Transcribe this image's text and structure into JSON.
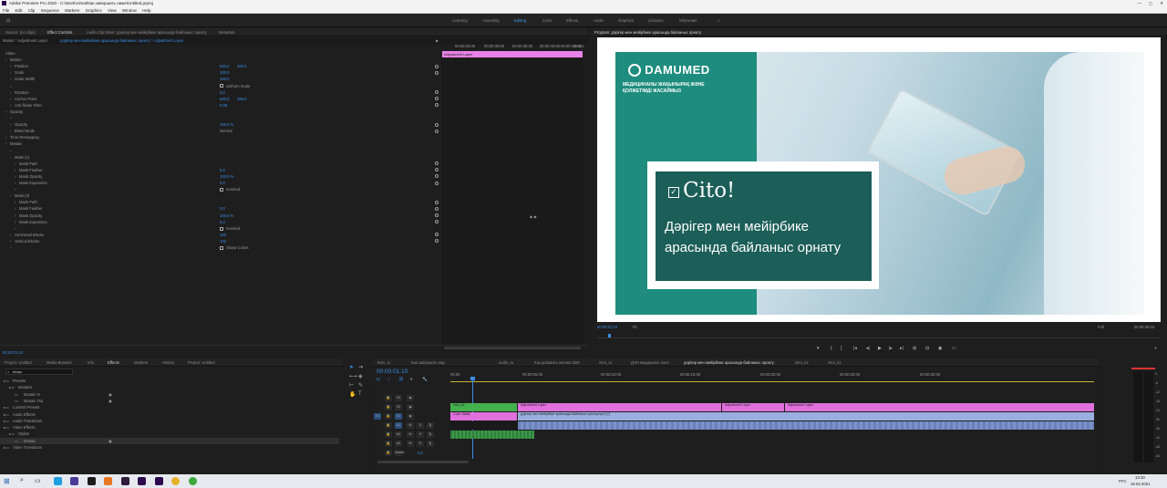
{
  "titlebar": {
    "title": "Adobe Premiere Pro 2020 - C:\\Work\\Almat\\Как завершить ниже\\Untitled.prproj"
  },
  "menu": [
    "File",
    "Edit",
    "Clip",
    "Sequence",
    "Markers",
    "Graphics",
    "View",
    "Window",
    "Help"
  ],
  "workspaces": [
    "Learning",
    "Assembly",
    "Editing",
    "Color",
    "Effects",
    "Audio",
    "Graphics",
    "Libraries",
    "Обучение"
  ],
  "workspace_active": "Editing",
  "source_tabs": {
    "source": "Source: (no clips)",
    "effect_controls": "Effect Controls",
    "audio_mixer": "Audio Clip Mixer: дәрігер мен мейірбике арасында байланыс орнату",
    "metadata": "Metadata"
  },
  "ec_header": {
    "master": "Master * Adjustment Layer",
    "sequence": "дәрігер мен мейірбике арасында байланыс орнату * Adjustment Layer",
    "clip": "Adjustment Layer"
  },
  "ec_timecodes": [
    "00:00:25:00",
    "00:00:30:00",
    "00:00:35:00",
    "00:00:40:00",
    "00:00:45:00",
    "00:01"
  ],
  "ec_rows": [
    {
      "label": "Video",
      "v1": "",
      "v2": "",
      "indent": 0
    },
    {
      "label": "Motion",
      "v1": "",
      "v2": "",
      "indent": 1
    },
    {
      "label": "Position",
      "v1": "640,0",
      "v2": "360,0",
      "indent": 2
    },
    {
      "label": "Scale",
      "v1": "100,0",
      "v2": "",
      "indent": 2
    },
    {
      "label": "Scale Width",
      "v1": "100,0",
      "v2": "",
      "indent": 2
    },
    {
      "label": "",
      "v1": "Uniform Scale",
      "v2": "",
      "indent": 2
    },
    {
      "label": "Rotation",
      "v1": "0,0",
      "v2": "",
      "indent": 2
    },
    {
      "label": "Anchor Point",
      "v1": "640,0",
      "v2": "360,0",
      "indent": 2
    },
    {
      "label": "Anti-flicker Filter",
      "v1": "0,00",
      "v2": "",
      "indent": 2
    },
    {
      "label": "Opacity",
      "v1": "",
      "v2": "",
      "indent": 1
    },
    {
      "label": "",
      "v1": "",
      "v2": "",
      "indent": 2
    },
    {
      "label": "Opacity",
      "v1": "100,0 %",
      "v2": "",
      "indent": 2
    },
    {
      "label": "Blend Mode",
      "v1": "Normal",
      "v2": "",
      "indent": 2
    },
    {
      "label": "Time Remapping",
      "v1": "",
      "v2": "",
      "indent": 1
    },
    {
      "label": "Mosaic",
      "v1": "",
      "v2": "",
      "indent": 1
    },
    {
      "label": "",
      "v1": "",
      "v2": "",
      "indent": 2
    },
    {
      "label": "Mask (1)",
      "v1": "",
      "v2": "",
      "indent": 2
    },
    {
      "label": "Mask Path",
      "v1": "",
      "v2": "",
      "indent": 3
    },
    {
      "label": "Mask Feather",
      "v1": "0,0",
      "v2": "",
      "indent": 3
    },
    {
      "label": "Mask Opacity",
      "v1": "100,0 %",
      "v2": "",
      "indent": 3
    },
    {
      "label": "Mask Expansion",
      "v1": "0,0",
      "v2": "",
      "indent": 3
    },
    {
      "label": "",
      "v1": "Inverted",
      "v2": "",
      "indent": 3
    },
    {
      "label": "Mask (2)",
      "v1": "",
      "v2": "",
      "indent": 2
    },
    {
      "label": "Mask Path",
      "v1": "",
      "v2": "",
      "indent": 3
    },
    {
      "label": "Mask Feather",
      "v1": "0,0",
      "v2": "",
      "indent": 3
    },
    {
      "label": "Mask Opacity",
      "v1": "100,0 %",
      "v2": "",
      "indent": 3
    },
    {
      "label": "Mask Expansion",
      "v1": "0,0",
      "v2": "",
      "indent": 3
    },
    {
      "label": "",
      "v1": "Inverted",
      "v2": "",
      "indent": 3
    },
    {
      "label": "Horizontal Blocks",
      "v1": "100",
      "v2": "",
      "indent": 2
    },
    {
      "label": "Vertical Blocks",
      "v1": "100",
      "v2": "",
      "indent": 2
    },
    {
      "label": "",
      "v1": "Sharp Colors",
      "v2": "",
      "indent": 2
    }
  ],
  "ec_timecode": "00:00:01:10",
  "program": {
    "title": "Program: дәрігер мен мейірбике арасында байланыс орнату",
    "timecode": "00:00:01:10",
    "fit": "Fit",
    "quality": "Full",
    "duration": "00:00:49:16",
    "brand": "DAMUMED",
    "tagline1": "МЕДИЦИНАНЫ ЖАҚЫНЫРАҚ ЖӘНЕ",
    "tagline2": "ҚОЛЖЕТІМДІ ЖАСАЙМЫЗ",
    "cito": "Cito!",
    "headline1": "Дәрігер мен мейірбике",
    "headline2": "арасында байланыс орнату",
    "colors": {
      "teal": "#1e8c7e",
      "dark_teal": "#1c5e58"
    }
  },
  "project_tabs": [
    "Project: Untitled",
    "Media Browser",
    "Info",
    "Effects",
    "Markers",
    "History",
    "Project: Untitled"
  ],
  "project_active": "Effects",
  "effects_search": "mosa",
  "effects_tree": [
    {
      "label": "Presets",
      "indent": 0
    },
    {
      "label": "Mosaics",
      "indent": 1
    },
    {
      "label": "Mosaic In",
      "indent": 2
    },
    {
      "label": "Mosaic Out",
      "indent": 2
    },
    {
      "label": "Lumetri Presets",
      "indent": 0
    },
    {
      "label": "Audio Effects",
      "indent": 0
    },
    {
      "label": "Audio Transitions",
      "indent": 0
    },
    {
      "label": "Video Effects",
      "indent": 0
    },
    {
      "label": "Stylize",
      "indent": 1
    },
    {
      "label": "Mosaic",
      "indent": 2
    },
    {
      "label": "Video Transitions",
      "indent": 0
    }
  ],
  "timeline_tabs": [
    "Intro_ru",
    "Как завершить пар",
    "audio_ru",
    "Как добавить кнопки ЭЗИ",
    "intro_ru",
    "ДЭН медицинск. киос",
    "дәрігер мен мейірбике арасында байланыс орнату",
    "intro_kz",
    "intro_kz"
  ],
  "timeline_active": "дәрігер мен мейірбике арасында байланыс орнату",
  "timeline_timecode": "00:00:01:10",
  "ruler": [
    "00:00",
    "00:00:05:00",
    "00:00:10:00",
    "00:00:15:00",
    "00:00:20:00",
    "00:00:25:00",
    "00:00:30:00"
  ],
  "tracks": [
    "V3",
    "V2",
    "V1",
    "A1",
    "A2",
    "A3",
    "Master"
  ],
  "master_value": "0,0",
  "clips": {
    "v3_intro": "intro_kz",
    "v3_adj1": "Adjustment Layer",
    "v3_adj2": "Adjustment Layer",
    "v3_adj3": "Adjustment Layer",
    "v2_color": "Color Matte",
    "v2_main": "дәрігер мен мейірбике арасында байланыс орнату.mp4 [V]"
  },
  "tools": [
    "selection",
    "track-select",
    "ripple",
    "razor",
    "slip",
    "pen",
    "hand",
    "type"
  ],
  "meter_labels": [
    "0",
    "-6",
    "-12",
    "-18",
    "-24",
    "-30",
    "-36",
    "-42",
    "-48",
    "-54"
  ],
  "taskbar": {
    "time": "13:30",
    "date": "16.04.2021",
    "lang": "РУС"
  }
}
